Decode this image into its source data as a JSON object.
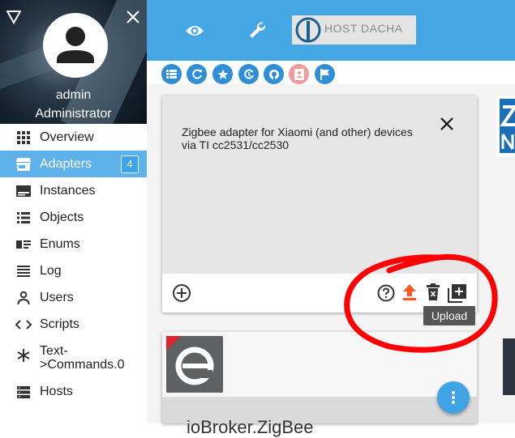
{
  "user": {
    "name": "admin",
    "role": "Administrator"
  },
  "nav": [
    {
      "id": "overview",
      "label": "Overview",
      "icon": "grid-icon"
    },
    {
      "id": "adapters",
      "label": "Adapters",
      "icon": "store-icon",
      "badge": "4",
      "active": true
    },
    {
      "id": "instances",
      "label": "Instances",
      "icon": "instances-icon"
    },
    {
      "id": "objects",
      "label": "Objects",
      "icon": "list-icon"
    },
    {
      "id": "enums",
      "label": "Enums",
      "icon": "enums-icon"
    },
    {
      "id": "log",
      "label": "Log",
      "icon": "log-icon"
    },
    {
      "id": "users",
      "label": "Users",
      "icon": "user-icon"
    },
    {
      "id": "scripts",
      "label": "Scripts",
      "icon": "code-icon"
    },
    {
      "id": "text-commands",
      "label": "Text-\n>Commands.0",
      "icon": "asterisk-icon"
    },
    {
      "id": "hosts",
      "label": "Hosts",
      "icon": "hosts-icon"
    }
  ],
  "topbar": {
    "host_label": "HOST DACHA"
  },
  "card": {
    "description": "Zigbee adapter for Xiaomi (and other) devices via TI cc2531/cc2530"
  },
  "tooltip": {
    "text": "Upload"
  },
  "card2": {
    "title": "ioBroker.ZigBee"
  },
  "colors": {
    "accent": "#44a7e4",
    "active_nav": "#5eb2ec",
    "upload_icon": "#ff5722",
    "annotation": "#ff0000"
  }
}
